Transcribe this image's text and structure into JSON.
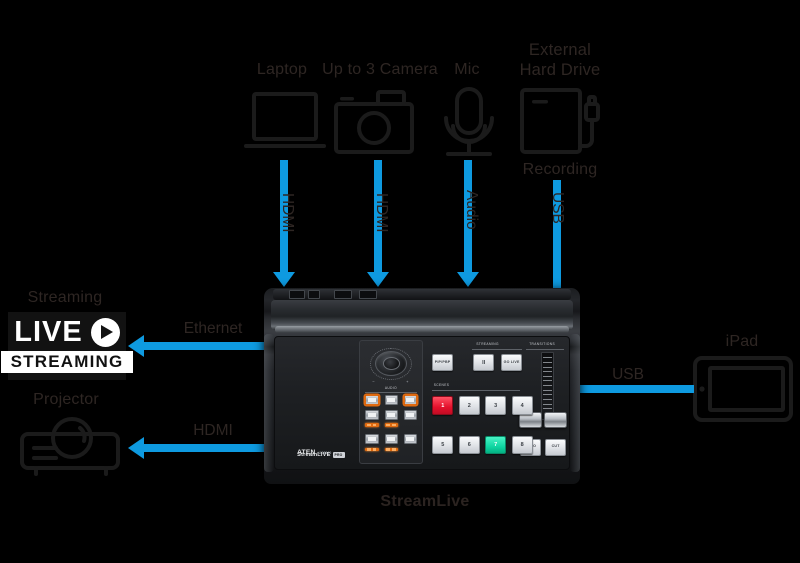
{
  "diagram": {
    "caption": "StreamLive",
    "sources": [
      {
        "id": "laptop",
        "label": "Laptop",
        "connection": "HDMI"
      },
      {
        "id": "camera",
        "label": "Up to 3 Camera",
        "connection": "HDMI"
      },
      {
        "id": "mic",
        "label": "Mic",
        "connection": "Audio"
      },
      {
        "id": "hdd",
        "label": "External\nHard Drive",
        "sublabel": "Recording",
        "connection": "USB"
      }
    ],
    "outputs_left": [
      {
        "id": "streaming",
        "label": "Streaming",
        "connection": "Ethernet"
      },
      {
        "id": "projector",
        "label": "Projector",
        "connection": "HDMI"
      }
    ],
    "outputs_right": [
      {
        "id": "ipad",
        "label": "iPad",
        "connection": "USB"
      }
    ],
    "live_badge": {
      "word": "LIVE",
      "bar": "STREAMING"
    }
  },
  "device": {
    "brand": "ATEN",
    "model": "UC9040",
    "product": "StreamLIVE",
    "product_badge": "PRO",
    "sections": {
      "audio": "AUDIO",
      "streaming": "STREAMING",
      "transitions": "TRANSITIONS",
      "scenes": "SCENES"
    },
    "audio_buttons": [
      {
        "id": "a1",
        "state": "active"
      },
      {
        "id": "a2",
        "state": "idle"
      },
      {
        "id": "a3",
        "state": "active"
      },
      {
        "id": "a4",
        "state": "idle"
      },
      {
        "id": "a5",
        "state": "idle"
      },
      {
        "id": "a6",
        "state": "idle"
      },
      {
        "id": "a7",
        "state": "idle"
      },
      {
        "id": "a8",
        "state": "idle"
      },
      {
        "id": "a9",
        "state": "idle"
      }
    ],
    "streaming_buttons": [
      {
        "id": "pause",
        "label": "II"
      },
      {
        "id": "golive",
        "label": "GO LIVE"
      }
    ],
    "pip_button": {
      "label": "PIP/PBP"
    },
    "scene_buttons": [
      {
        "label": "1",
        "state": "program"
      },
      {
        "label": "2",
        "state": "idle"
      },
      {
        "label": "3",
        "state": "idle"
      },
      {
        "label": "4",
        "state": "idle"
      },
      {
        "label": "5",
        "state": "idle"
      },
      {
        "label": "6",
        "state": "idle"
      },
      {
        "label": "7",
        "state": "preview"
      },
      {
        "label": "8",
        "state": "idle"
      }
    ],
    "transition_buttons": [
      {
        "id": "auto",
        "label": "AUTO"
      },
      {
        "id": "cut",
        "label": "CUT"
      }
    ]
  },
  "colors": {
    "background": "#000000",
    "arrow": "#0e9ae0",
    "label_text": "#2e2623",
    "program_red": "#e4112c",
    "preview_green": "#0fd6a2",
    "audio_orange": "#e06a10"
  }
}
